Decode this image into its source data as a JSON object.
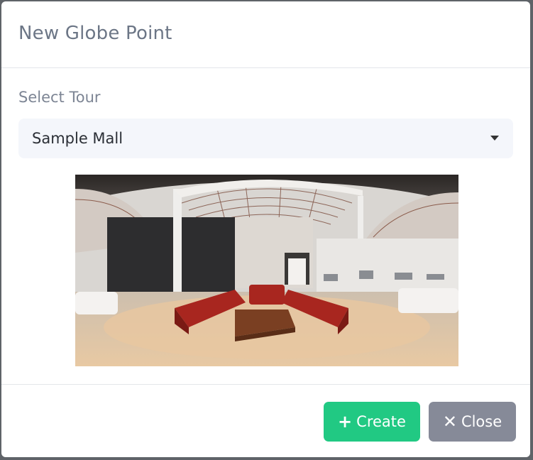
{
  "dialog": {
    "title": "New Globe Point"
  },
  "form": {
    "select_label": "Select Tour",
    "selected_tour": "Sample Mall"
  },
  "preview": {
    "description": "panorama-preview"
  },
  "footer": {
    "create_icon": "+",
    "create_label": "Create",
    "close_icon": "✕",
    "close_label": "Close"
  },
  "colors": {
    "create_button": "#21c983",
    "close_button": "#868a98",
    "select_background": "#f4f6fb"
  }
}
